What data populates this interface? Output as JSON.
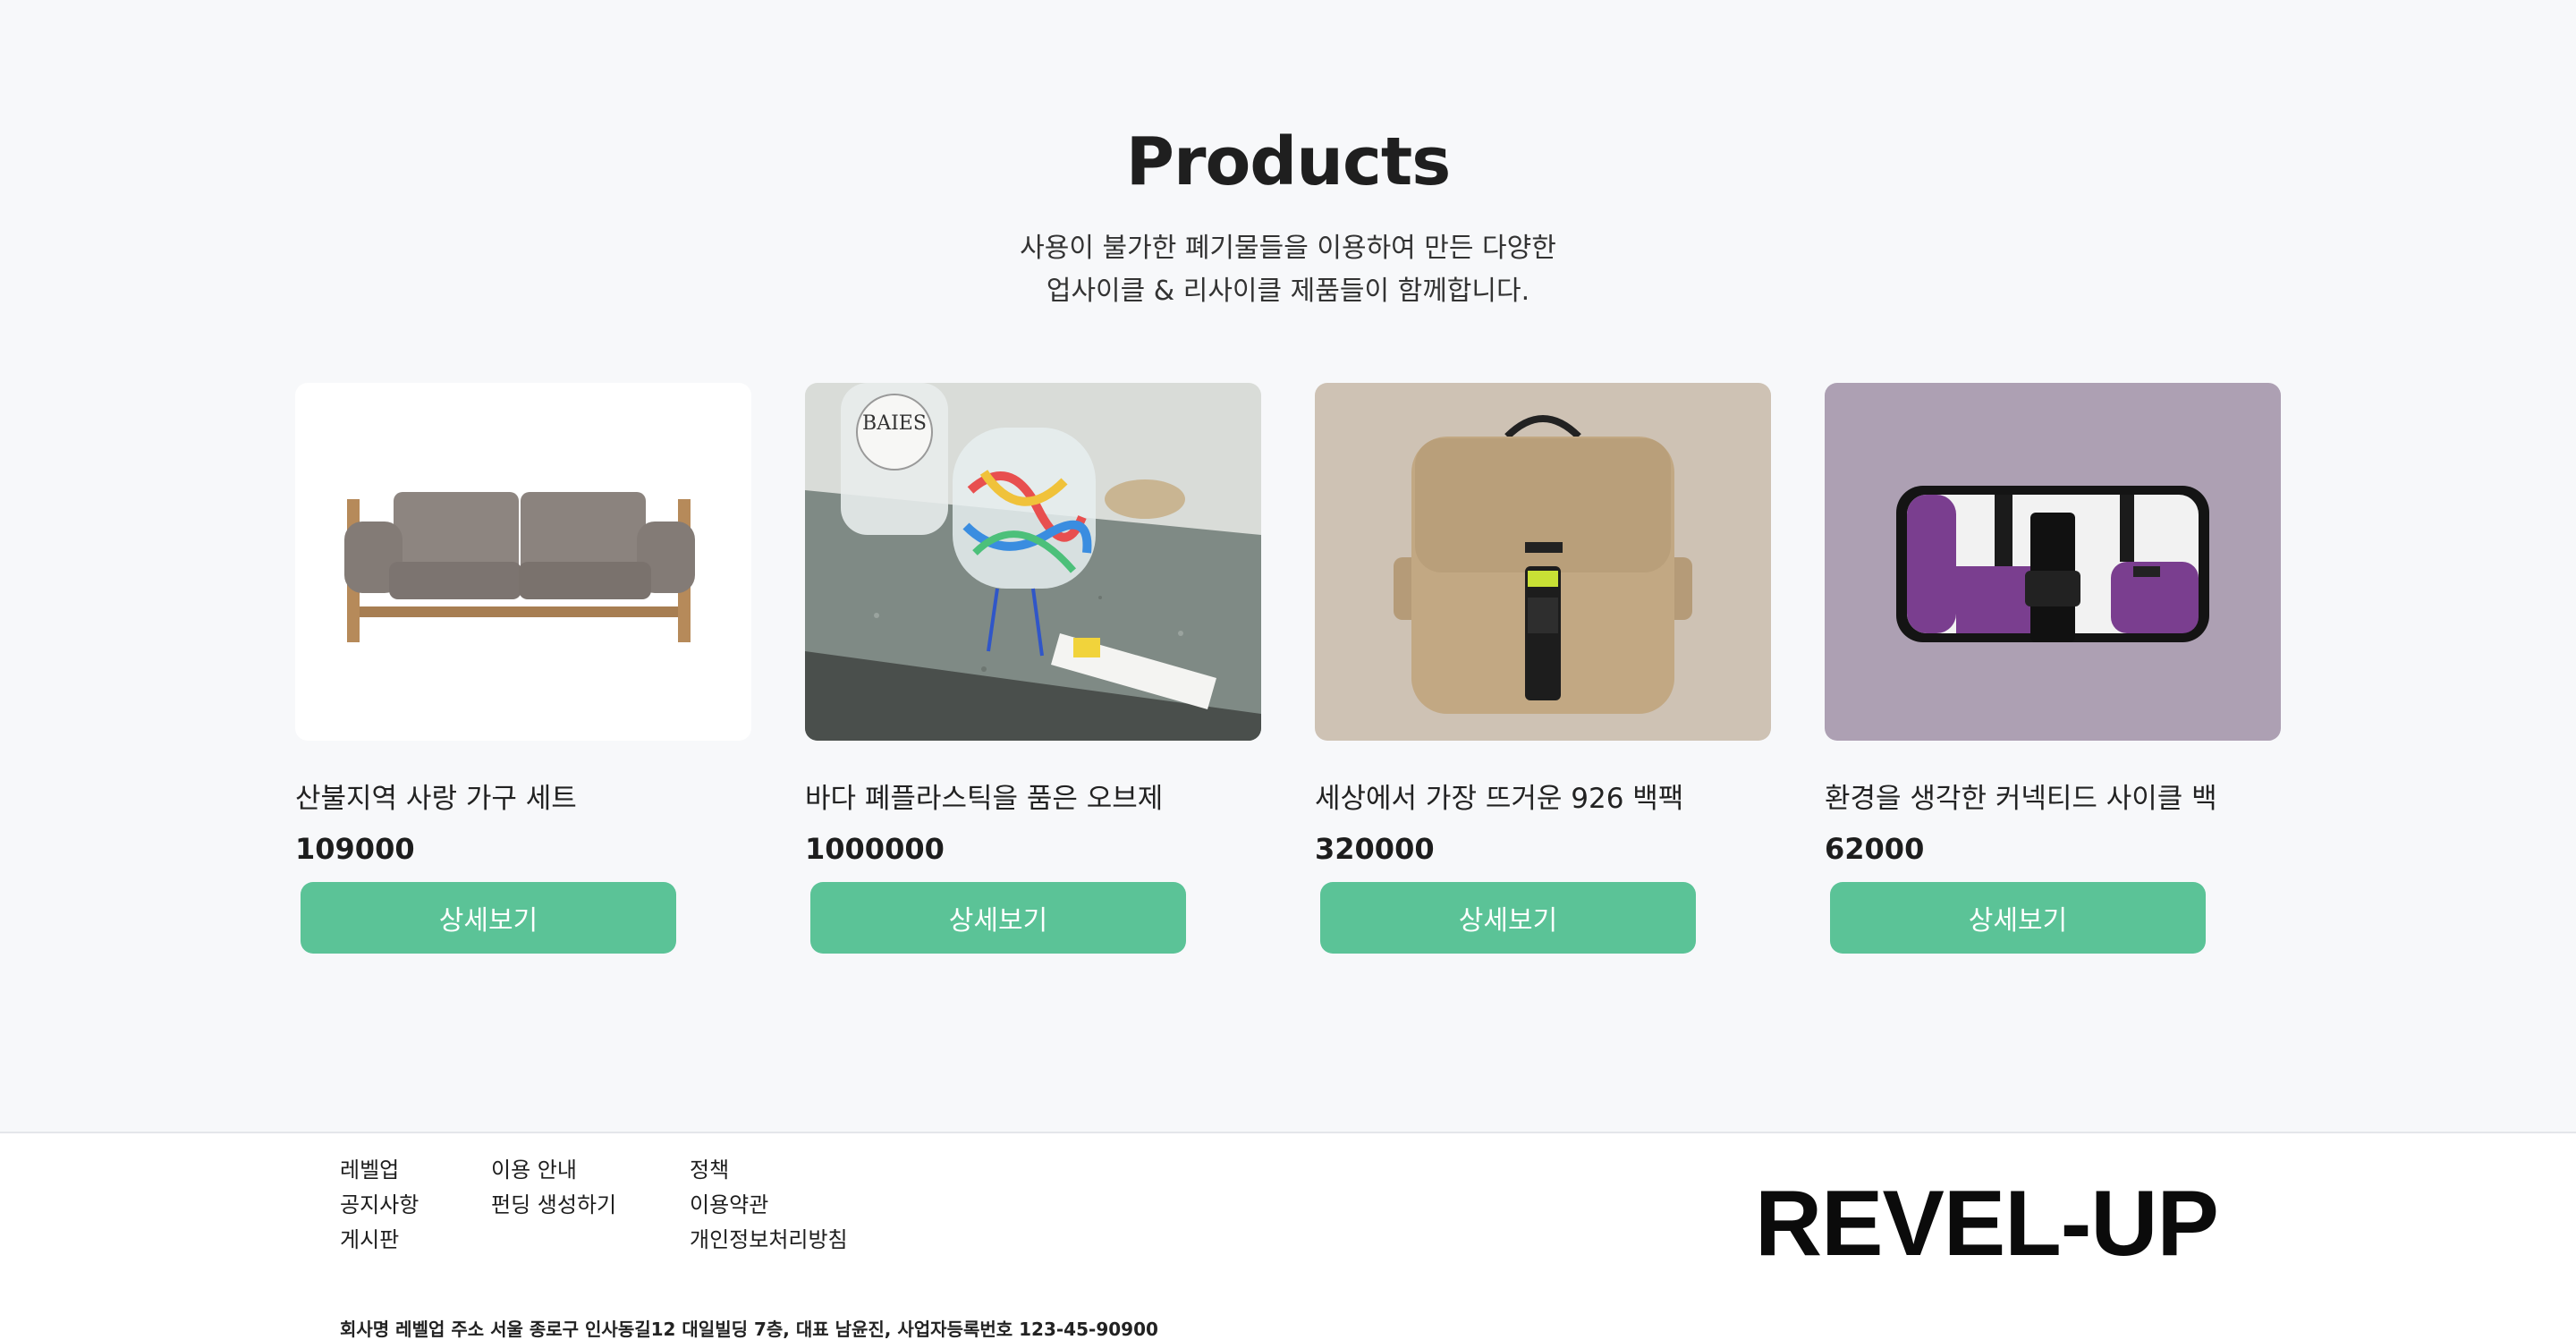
{
  "section": {
    "title": "Products",
    "subtitle_line1": "사용이 불가한 폐기물들을 이용하여 만든 다양한",
    "subtitle_line2": "업사이클 & 리사이클 제품들이 함께합니다."
  },
  "products": [
    {
      "name": "산불지역 사랑 가구 세트",
      "price": "109000",
      "button": "상세보기",
      "image": "sofa-image"
    },
    {
      "name": "바다 폐플라스틱을 품은 오브제",
      "price": "1000000",
      "button": "상세보기",
      "image": "plastic-object-image"
    },
    {
      "name": "세상에서 가장 뜨거운 926 백팩",
      "price": "320000",
      "button": "상세보기",
      "image": "backpack-image"
    },
    {
      "name": "환경을 생각한 커넥티드 사이클 백",
      "price": "62000",
      "button": "상세보기",
      "image": "cycle-bag-image"
    }
  ],
  "footer": {
    "col1": [
      "레벨업",
      "공지사항",
      "게시판"
    ],
    "col2": [
      "이용 안내",
      "펀딩 생성하기"
    ],
    "col3": [
      "정책",
      "이용약관",
      "개인정보처리방침"
    ],
    "logo": "REVEL-UP",
    "info": "회사명 레벨업 주소 서울 종로구 인사동길12 대일빌딩 7층, 대표 남윤진, 사업자등록번호 123-45-90900"
  },
  "colors": {
    "page_bg": "#f7f8fa",
    "button": "#5bc397",
    "footer_bg": "#ffffff"
  }
}
